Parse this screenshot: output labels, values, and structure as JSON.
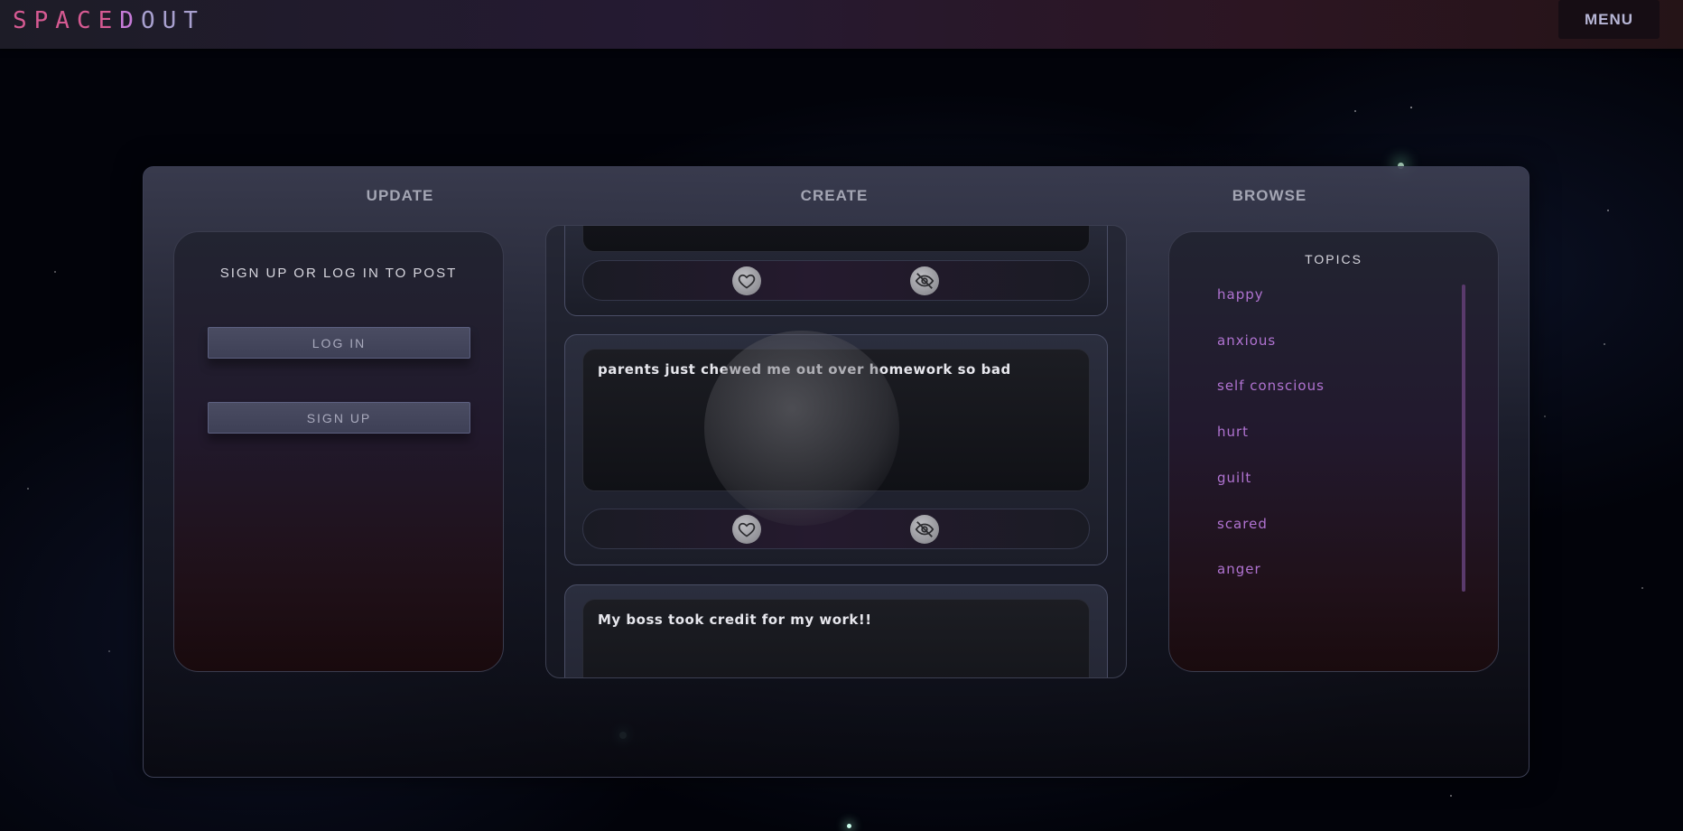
{
  "header": {
    "logo_part1": "SPACE",
    "logo_part2": "D",
    "logo_part3": "OUT",
    "menu_label": "MENU"
  },
  "columns": {
    "update": "UPDATE",
    "create": "CREATE",
    "browse": "BROWSE"
  },
  "auth": {
    "prompt": "SIGN UP OR LOG IN TO POST",
    "login_label": "LOG IN",
    "signup_label": "SIGN UP"
  },
  "feed": {
    "posts": [
      {
        "text": ""
      },
      {
        "text": "parents just chewed me out over homework so bad"
      },
      {
        "text": "My boss took credit for my work!!"
      }
    ],
    "icons": {
      "like": "heart-icon",
      "hide": "eye-slash-icon"
    }
  },
  "topics": {
    "title": "TOPICS",
    "items": [
      "happy",
      "anxious",
      "self conscious",
      "hurt",
      "guilt",
      "scared",
      "anger"
    ]
  },
  "colors": {
    "logo_pink": "#d65a92",
    "logo_purple": "#c77bd9",
    "topic_purple": "#b073d1",
    "panel_border": "#3c3f55"
  }
}
